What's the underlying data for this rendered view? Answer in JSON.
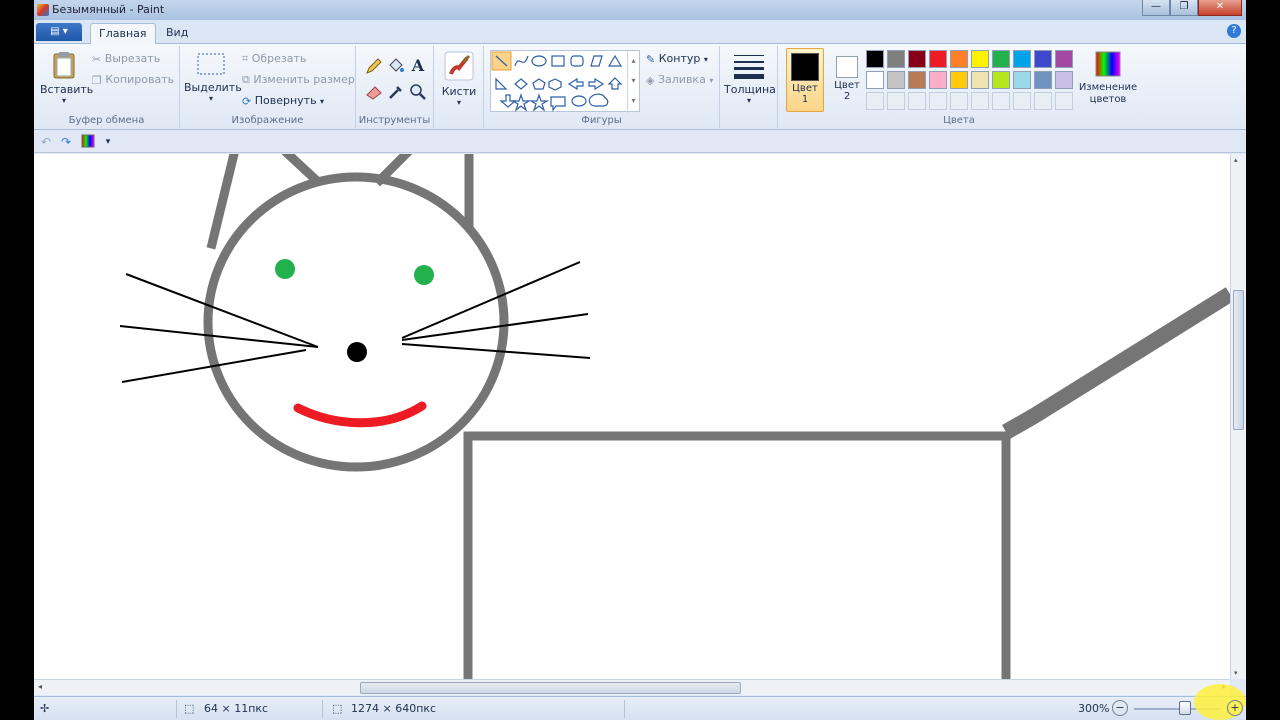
{
  "window": {
    "title": "Безымянный - Paint"
  },
  "tabs": {
    "file": "▤ ▾",
    "home": "Главная",
    "view": "Вид"
  },
  "clipboard": {
    "paste": "Вставить",
    "cut": "Вырезать",
    "copy": "Копировать",
    "label": "Буфер обмена"
  },
  "image": {
    "select": "Выделить",
    "crop": "Обрезать",
    "resize": "Изменить размер",
    "rotate": "Повернуть",
    "label": "Изображение"
  },
  "tools": {
    "label": "Инструменты",
    "text_tool": "A"
  },
  "brushes": {
    "label": "Кисти"
  },
  "shapes": {
    "label": "Фигуры",
    "outline": "Контур",
    "fill": "Заливка"
  },
  "thickness": {
    "label": "Толщина"
  },
  "colors": {
    "color1_label": "Цвет",
    "color1_num": "1",
    "color2_label": "Цвет",
    "color2_num": "2",
    "edit_label": "Изменение",
    "edit_label2": "цветов",
    "label": "Цвета",
    "color1_value": "#000000",
    "color2_value": "#ffffff",
    "palette_row1": [
      "#000000",
      "#7f7f7f",
      "#880015",
      "#ed1c24",
      "#ff7f27",
      "#fff200",
      "#22b14c",
      "#00a2e8",
      "#3f48cc",
      "#a349a4"
    ],
    "palette_row2": [
      "#ffffff",
      "#c3c3c3",
      "#b97a57",
      "#ffaec9",
      "#ffc90e",
      "#efe4b0",
      "#b5e61d",
      "#99d9ea",
      "#7092be",
      "#c8bfe7"
    ]
  },
  "status": {
    "selection_size": "64 × 11пкс",
    "image_size": "1274 × 640пкс",
    "zoom": "300%"
  }
}
